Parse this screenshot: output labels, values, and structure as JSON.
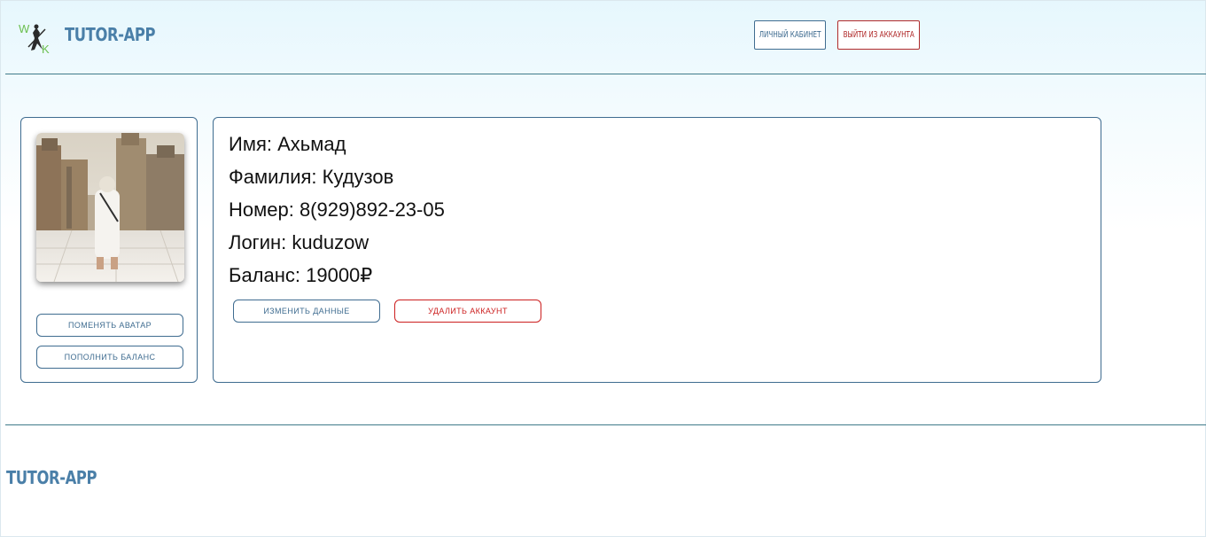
{
  "header": {
    "brand": "TUTOR-APP",
    "logo_letters": {
      "top": "W",
      "bottom": "K"
    },
    "cabinet_label": "ЛИЧНЫЙ КАБИНЕТ",
    "logout_label": "ВЫЙТИ ИЗ АККАУНТА"
  },
  "profile": {
    "change_avatar_label": "ПОМЕНЯТЬ АВАТАР",
    "top_up_label": "ПОПОЛНИТЬ БАЛАНС",
    "lines": {
      "name": "Имя: Ахьмад",
      "surname": "Фамилия: Кудузов",
      "phone": "Номер: 8(929)892-23-05",
      "login": "Логин: kuduzow",
      "balance": "Баланс: 19000₽"
    },
    "edit_label": "ИЗМЕНИТЬ ДАННЫЕ",
    "delete_label": "УДАЛИТЬ АККАУНТ"
  },
  "footer": {
    "brand": "TUTOR-APP"
  },
  "colors": {
    "accent": "#3f6c90",
    "brand": "#4a7fa8",
    "danger": "#cc1f1f",
    "divider": "#3f7a8a"
  }
}
